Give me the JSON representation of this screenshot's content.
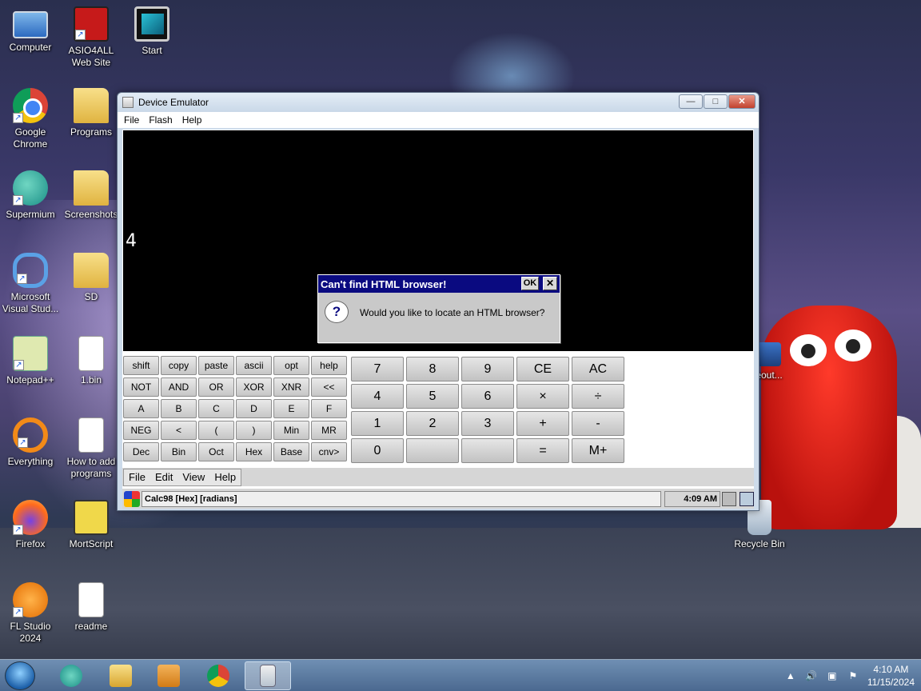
{
  "desktop": {
    "icons": [
      {
        "label": "Computer"
      },
      {
        "label": "ASIO4ALL Web Site"
      },
      {
        "label": "Start"
      },
      {
        "label": "Google Chrome"
      },
      {
        "label": "Programs"
      },
      {
        "label": "Supermium"
      },
      {
        "label": "Screenshots"
      },
      {
        "label": "Microsoft Visual Stud..."
      },
      {
        "label": "SD"
      },
      {
        "label": "Notepad++"
      },
      {
        "label": "1.bin"
      },
      {
        "label": "Everything"
      },
      {
        "label": "How to add programs"
      },
      {
        "label": "Firefox"
      },
      {
        "label": "MortScript"
      },
      {
        "label": "FL Studio 2024"
      },
      {
        "label": "readme"
      },
      {
        "label": "Recycle Bin"
      },
      {
        "label": "eout..."
      }
    ]
  },
  "window": {
    "title": "Device Emulator",
    "menu": [
      "File",
      "Flash",
      "Help"
    ],
    "controls": {
      "minimize": "—",
      "maximize": "□",
      "close": "✕"
    }
  },
  "calc": {
    "display_value": "4",
    "dialog": {
      "title": "Can't find HTML browser!",
      "ok": "OK",
      "close": "✕",
      "icon": "?",
      "message": "Would you like to locate an HTML browser?"
    },
    "func_keys": [
      [
        "shift",
        "copy",
        "paste",
        "ascii",
        "opt",
        "help"
      ],
      [
        "NOT",
        "AND",
        "OR",
        "XOR",
        "XNR",
        "<<"
      ],
      [
        "A",
        "B",
        "C",
        "D",
        "E",
        "F"
      ],
      [
        "NEG",
        "<",
        "(",
        ")",
        "Min",
        "MR"
      ],
      [
        "Dec",
        "Bin",
        "Oct",
        "Hex",
        "Base",
        "cnv>"
      ]
    ],
    "num_keys": [
      [
        "7",
        "8",
        "9",
        "CE",
        "AC"
      ],
      [
        "4",
        "5",
        "6",
        "×",
        "÷"
      ],
      [
        "1",
        "2",
        "3",
        "+",
        "-"
      ],
      [
        "0",
        "",
        "",
        "=",
        "M+"
      ]
    ],
    "menu": [
      "File",
      "Edit",
      "View",
      "Help"
    ],
    "taskbar_title": "Calc98 [Hex] [radians]",
    "clock": "4:09 AM"
  },
  "taskbar": {
    "time": "4:10 AM",
    "date": "11/15/2024",
    "tray": [
      "▲",
      "🔊",
      "▣",
      "⚑"
    ],
    "start_label": "Start"
  },
  "colors": {
    "dialog_title_bg": "#0a0a80",
    "screen_bg": "#000000",
    "taskbar_bg": "#5b7aa0"
  }
}
